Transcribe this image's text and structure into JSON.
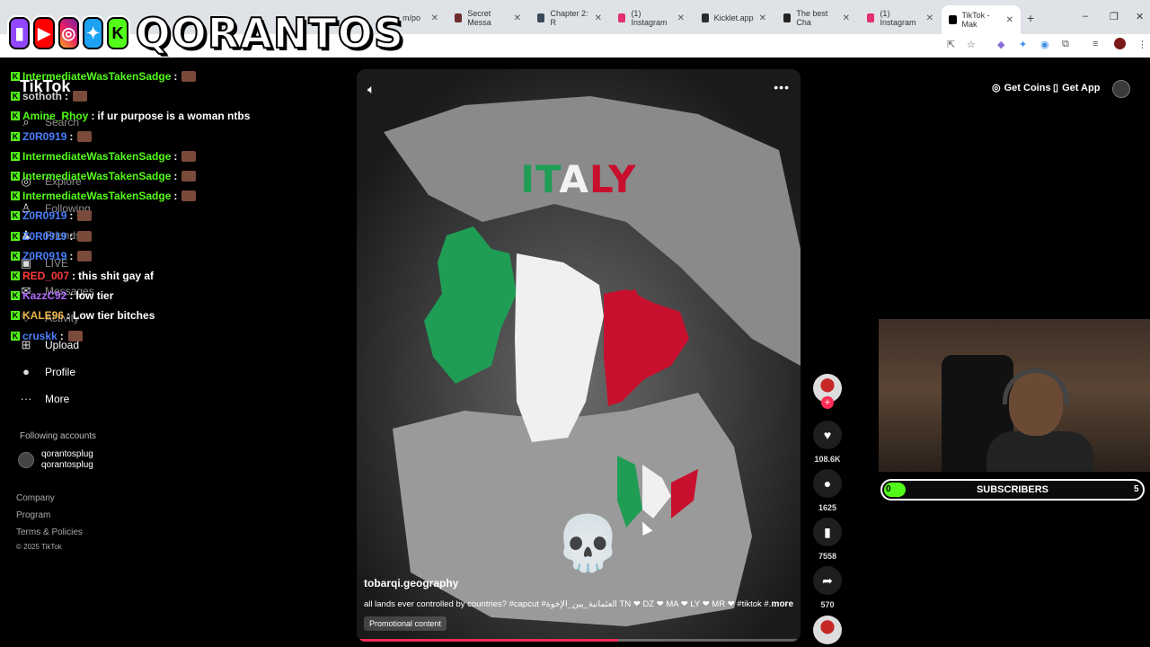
{
  "browser": {
    "tabs": [
      {
        "title": "m/po",
        "color": "#1f1f1f"
      },
      {
        "title": "Secret Messa",
        "color": "#6b2e2e"
      },
      {
        "title": "Chapter 2: R",
        "color": "#3b4a5a"
      },
      {
        "title": "(1) Instagram",
        "color": "#e1306c"
      },
      {
        "title": "Kicklet.app",
        "color": "#1a1a1a"
      },
      {
        "title": "The best Cha",
        "color": "#222222"
      },
      {
        "title": "(1) Instagram",
        "color": "#e1306c"
      },
      {
        "title": "TikTok - Mak",
        "color": "#000000"
      }
    ],
    "new_tab": "+",
    "minimize": "–",
    "restore": "❐",
    "close": "✕"
  },
  "overlay": {
    "channel_name": "QORANTOS",
    "logos": [
      "twitch-logo",
      "youtube-logo",
      "instagram-logo",
      "twitter-logo",
      "kick-logo"
    ]
  },
  "tiktok": {
    "logo": "TikTok",
    "nav": {
      "search": "Search",
      "explore": "Explore",
      "following": "Following",
      "friends": "Friends",
      "live": "LIVE",
      "messages": "Messages",
      "activity": "Activity",
      "upload": "Upload",
      "profile": "Profile",
      "more": "More"
    },
    "following_title": "Following accounts",
    "following_account": {
      "name": "qorantosplug",
      "handle": "qorantosplug"
    },
    "footer": {
      "company": "Company",
      "program": "Program",
      "terms": "Terms & Policies",
      "copyright": "© 2025 TikTok"
    },
    "top": {
      "get_coins": "Get Coins",
      "get_app": "Get App"
    }
  },
  "chat": [
    {
      "user": "IntermediateWasTakenSadge",
      "color": "#53fc18",
      "text": ""
    },
    {
      "user": "sothoth",
      "color": "#d0d0d0",
      "text": ""
    },
    {
      "user": "Amine_Rhoy",
      "color": "#53fc18",
      "text": "if ur purpose is a woman ntbs"
    },
    {
      "user": "Z0R0919",
      "color": "#4a7fff",
      "text": ""
    },
    {
      "user": "IntermediateWasTakenSadge",
      "color": "#53fc18",
      "text": ""
    },
    {
      "user": "IntermediateWasTakenSadge",
      "color": "#53fc18",
      "text": ""
    },
    {
      "user": "IntermediateWasTakenSadge",
      "color": "#53fc18",
      "text": ""
    },
    {
      "user": "Z0R0919",
      "color": "#4a7fff",
      "text": ""
    },
    {
      "user": "Z0R0919",
      "color": "#4a7fff",
      "text": ""
    },
    {
      "user": "Z0R0919",
      "color": "#4a7fff",
      "text": ""
    },
    {
      "user": "RED_007",
      "color": "#ff3b3b",
      "text": "this shit gay af"
    },
    {
      "user": "KazzC92",
      "color": "#b06bff",
      "text": "low tier"
    },
    {
      "user": "KALE96",
      "color": "#e8b44a",
      "text": "Low tier bitches"
    },
    {
      "user": "cruskk",
      "color": "#4a7fff",
      "text": ""
    }
  ],
  "video": {
    "title": "ITALY",
    "author": "tobarqi.geography",
    "caption": "all lands ever controlled by countries? #capcut #العثمانية_بين_الإخوة TN ❤ DZ ❤ MA ❤ LY ❤ MR ❤ #tiktok #...",
    "more_label": "more",
    "promo_label": "Promotional content",
    "skull_emoji": "💀",
    "progress": 0.59,
    "colors": {
      "green": "#1f9d55",
      "white": "#f2f2f2",
      "red": "#c8102e"
    }
  },
  "actions": {
    "likes": "108.6K",
    "comments": "1625",
    "saves": "7558",
    "shares": "570"
  },
  "subscribers": {
    "label": "SUBSCRIBERS",
    "current": "0",
    "goal": "5",
    "progress": 0
  }
}
